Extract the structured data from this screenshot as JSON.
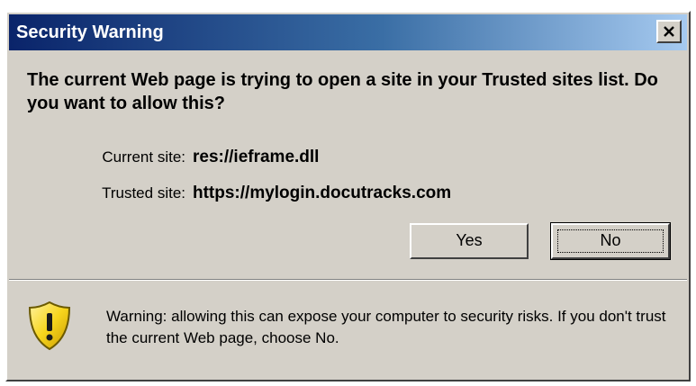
{
  "window": {
    "title": "Security Warning",
    "close_icon": "close-icon"
  },
  "message": "The current Web page is trying to open a site in your Trusted sites list. Do you want to allow this?",
  "sites": {
    "current_label": "Current site:",
    "current_value": "res://ieframe.dll",
    "trusted_label": "Trusted site:",
    "trusted_value": "https://mylogin.docutracks.com"
  },
  "buttons": {
    "yes_label": "Yes",
    "no_label": "No",
    "default": "No"
  },
  "warning": {
    "icon": "shield-warning-icon",
    "text": "Warning: allowing this can expose your computer to security risks. If you don't trust the current Web page, choose No."
  },
  "colors": {
    "dialog_background": "#d4d0c8",
    "titlebar_start": "#0a246a",
    "titlebar_end": "#a6caf0",
    "shield_yellow": "#f7d51d"
  }
}
